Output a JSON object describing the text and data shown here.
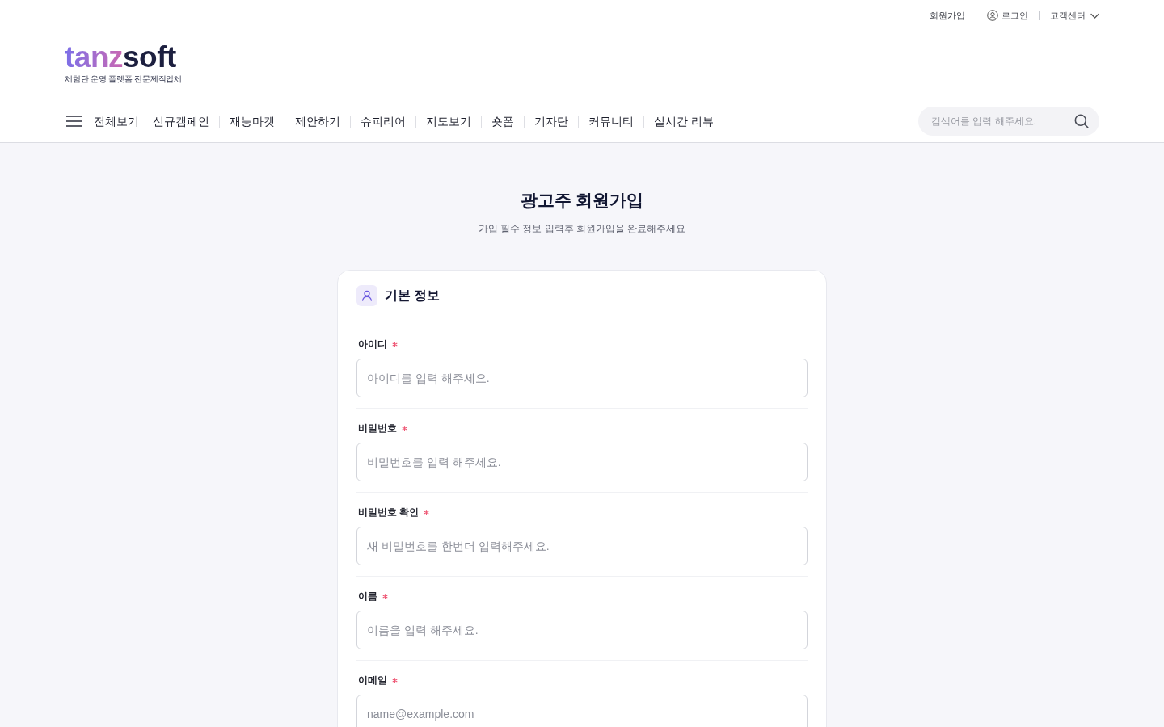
{
  "utility_nav": [
    {
      "kind": "text",
      "label": "회원가입"
    },
    {
      "kind": "login",
      "label": "로그인"
    },
    {
      "kind": "dropdown",
      "label": "고객센터"
    }
  ],
  "logo": {
    "accent": "tanz",
    "rest": "soft",
    "tagline": "체험단 운영 플렛폼 전문제작업체"
  },
  "main_nav": {
    "all_menu": {
      "label": "전체보기"
    },
    "items": [
      {
        "label": "신규캠페인"
      },
      {
        "label": "재능마켓"
      },
      {
        "label": "제안하기"
      },
      {
        "label": "슈피리어"
      },
      {
        "label": "지도보기"
      },
      {
        "label": "숏폼"
      },
      {
        "label": "기자단"
      },
      {
        "label": "커뮤니티"
      },
      {
        "label": "실시간 리뷰"
      }
    ]
  },
  "search": {
    "placeholder": "검색어를 입력 해주세요."
  },
  "page": {
    "title": "광고주 회원가입",
    "subtitle": "가입 필수 정보 입력후 회원가입을 완료해주세요"
  },
  "form": {
    "section_title": "기본 정보",
    "fields": [
      {
        "label": "아이디",
        "required": true,
        "placeholder": "아이디를 입력 해주세요."
      },
      {
        "label": "비밀번호",
        "required": true,
        "placeholder": "비밀번호를 입력 해주세요."
      },
      {
        "label": "비밀번호 확인",
        "required": true,
        "placeholder": "새 비밀번호를 한번더 입력해주세요."
      },
      {
        "label": "이름",
        "required": true,
        "placeholder": "이름을 입력 해주세요."
      },
      {
        "label": "이메일",
        "required": true,
        "placeholder": "name@example.com"
      }
    ]
  }
}
